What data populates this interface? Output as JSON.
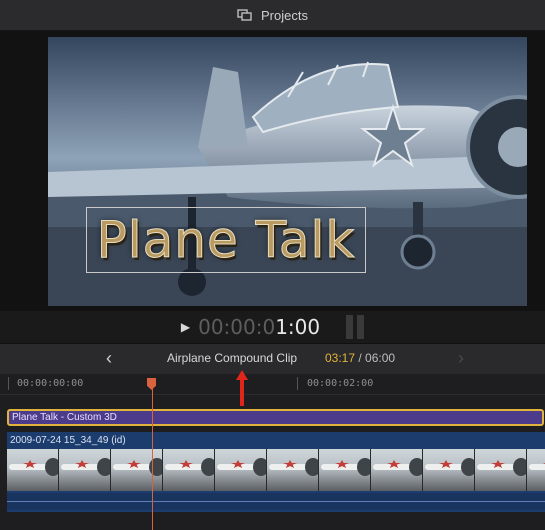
{
  "window": {
    "title": "Projects"
  },
  "viewer": {
    "title_text": "Plane Talk",
    "timecode_dim": "00:00:0",
    "timecode_lit": "1:00"
  },
  "navbar": {
    "clip_name": "Airplane Compound Clip",
    "current_duration": "03:17",
    "total_duration": "/ 06:00"
  },
  "timeline": {
    "ruler_labels": [
      "00:00:00:00",
      "00:00:02:00"
    ],
    "title_clip_label": "Plane Talk - Custom 3D",
    "video_clip_label": "2009-07-24 15_34_49 (id)"
  },
  "colors": {
    "accent_playhead": "#d9623f",
    "selection": "#e0b43a",
    "title_clip": "#4b3b8a",
    "video_clip": "#1c3c6e",
    "arrow": "#e0261b"
  },
  "icons": [
    "projects-icon",
    "play-icon",
    "back-chevron-icon",
    "forward-chevron-icon",
    "playhead-icon",
    "annotation-arrow-icon"
  ]
}
